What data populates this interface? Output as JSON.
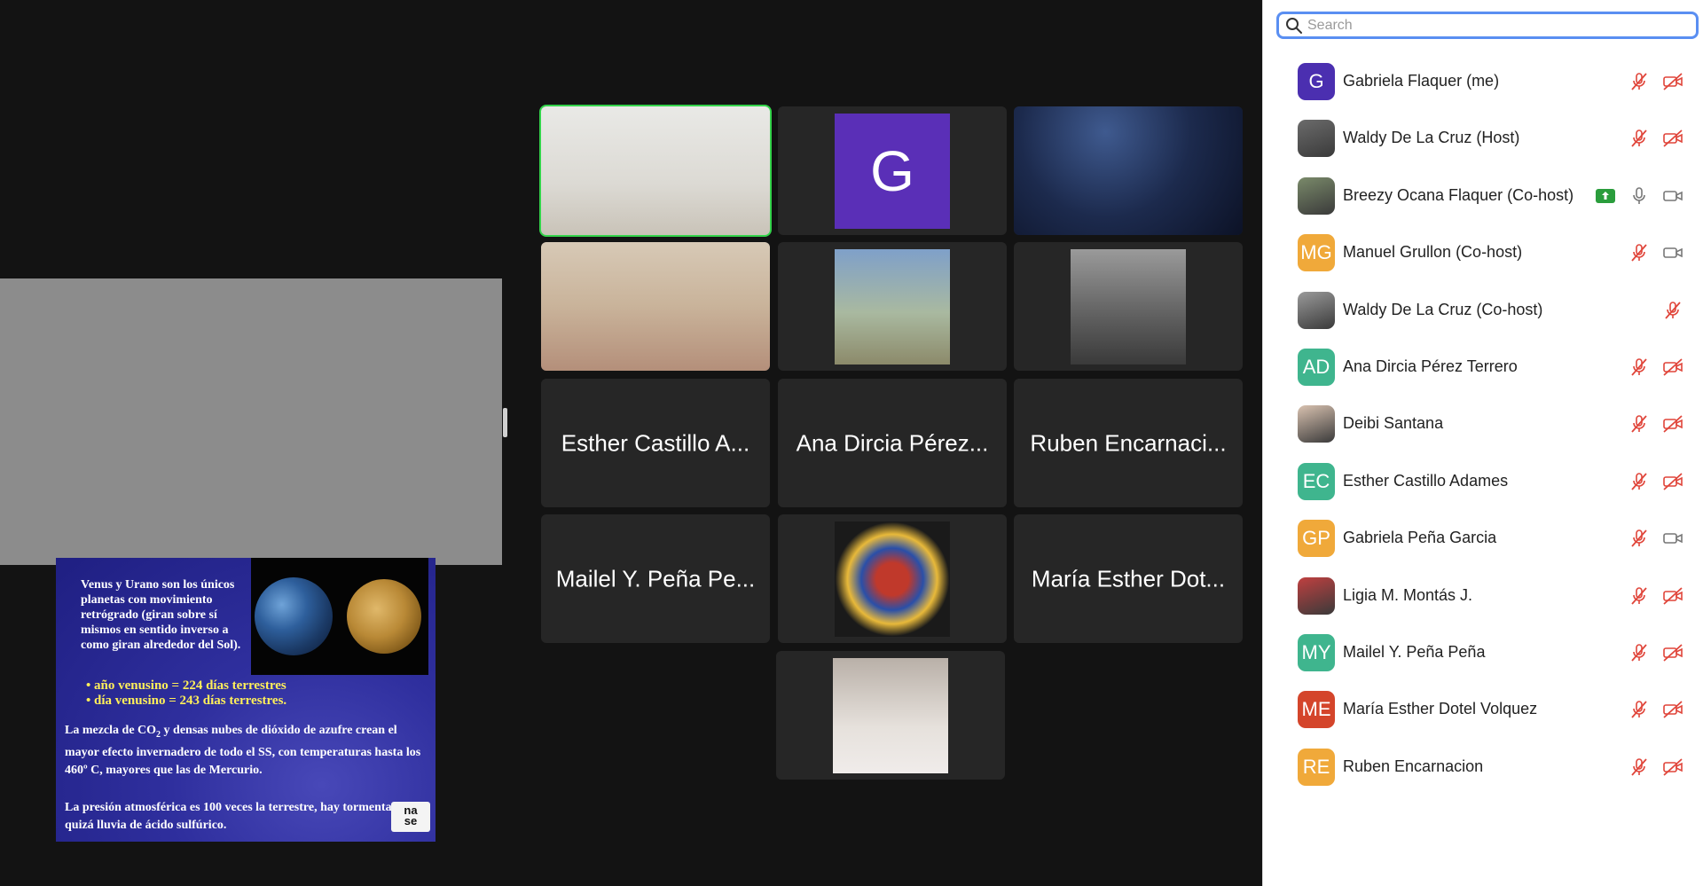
{
  "slide": {
    "intro": "Venus y Urano son los únicos planetas con movimiento retrógrado (giran sobre sí mismos en sentido inverso a como giran alrededor del Sol).",
    "bullet1": "• año venusino = 224 días terrestres",
    "bullet2": "• día venusino = 243 días terrestres.",
    "para1_a": "La mezcla de CO",
    "para1_sub": "2",
    "para1_b": " y densas nubes de dióxido de azufre crean el mayor efecto invernadero de todo el SS, con temperaturas hasta los 460º C, mayores que las de Mercurio.",
    "para2": "La presión atmosférica es 100 veces la terrestre, hay tormentas y quizá lluvia de ácido sulfúrico.",
    "logo_line1": "na",
    "logo_line2": "se"
  },
  "gallery": {
    "tiles": [
      {
        "type": "video"
      },
      {
        "type": "avatar",
        "initial": "G",
        "color": "#5a2fb7"
      },
      {
        "type": "video"
      },
      {
        "type": "video"
      },
      {
        "type": "video"
      },
      {
        "type": "video"
      },
      {
        "type": "name",
        "label": "Esther Castillo A..."
      },
      {
        "type": "name",
        "label": "Ana Dircia Pérez..."
      },
      {
        "type": "name",
        "label": "Ruben Encarnaci..."
      },
      {
        "type": "name",
        "label": "Mailel Y. Peña Pe..."
      },
      {
        "type": "image"
      },
      {
        "type": "name",
        "label": "María Esther Dot..."
      },
      {
        "type": "video"
      }
    ]
  },
  "participants": {
    "search_placeholder": "Search",
    "list": [
      {
        "initials": "G",
        "color": "#4b2fb0",
        "name": "Gabriela Flaquer (me)",
        "mic": "muted",
        "cam": "off"
      },
      {
        "initials": "",
        "color": "#6b6b6b",
        "name": "Waldy De La Cruz (Host)",
        "mic": "muted",
        "cam": "off"
      },
      {
        "initials": "",
        "color": "#7a8a6a",
        "name": "Breezy Ocana Flaquer (Co-host)",
        "mic": "on",
        "cam": "on",
        "sharing": true
      },
      {
        "initials": "MG",
        "color": "#f0a93a",
        "name": "Manuel Grullon (Co-host)",
        "mic": "muted",
        "cam": "on"
      },
      {
        "initials": "",
        "color": "#9a9a9a",
        "name": "Waldy De La Cruz (Co-host)",
        "mic": "muted",
        "cam": "none"
      },
      {
        "initials": "AD",
        "color": "#3fb58e",
        "name": "Ana Dircia Pérez Terrero",
        "mic": "muted",
        "cam": "off"
      },
      {
        "initials": "",
        "color": "#d9c2b0",
        "name": "Deibi Santana",
        "mic": "muted",
        "cam": "off"
      },
      {
        "initials": "EC",
        "color": "#3fb58e",
        "name": "Esther Castillo Adames",
        "mic": "muted",
        "cam": "off"
      },
      {
        "initials": "GP",
        "color": "#f0a93a",
        "name": "Gabriela Peña Garcia",
        "mic": "muted",
        "cam": "on"
      },
      {
        "initials": "",
        "color": "#c04040",
        "name": "Ligia  M. Montás J.",
        "mic": "muted",
        "cam": "off"
      },
      {
        "initials": "MY",
        "color": "#3fb58e",
        "name": "Mailel Y. Peña Peña",
        "mic": "muted",
        "cam": "off"
      },
      {
        "initials": "ME",
        "color": "#d4452b",
        "name": "María Esther Dotel Volquez",
        "mic": "muted",
        "cam": "off"
      },
      {
        "initials": "RE",
        "color": "#f0a93a",
        "name": "Ruben Encarnacion",
        "mic": "muted",
        "cam": "off"
      }
    ]
  }
}
